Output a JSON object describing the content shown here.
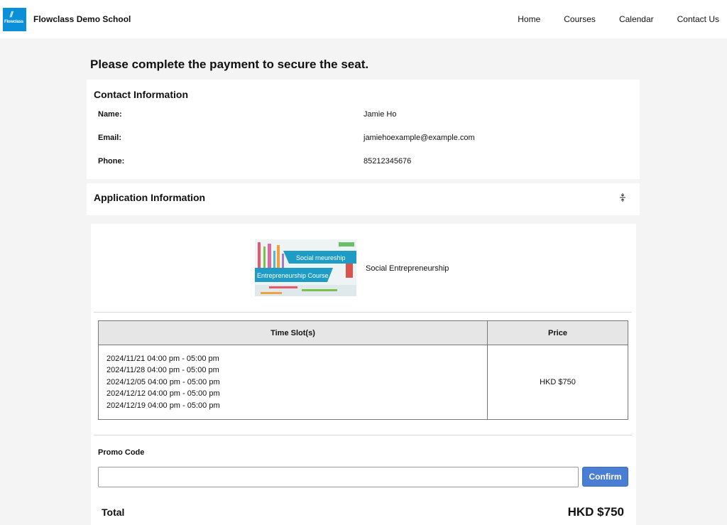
{
  "header": {
    "logo_text": "Flowclass",
    "school_name": "Flowclass Demo School",
    "nav": [
      "Home",
      "Courses",
      "Calendar",
      "Contact Us"
    ]
  },
  "page_heading": "Please complete the payment to secure the seat.",
  "contact": {
    "title": "Contact Information",
    "fields": [
      {
        "label": "Name:",
        "value": "Jamie Ho"
      },
      {
        "label": "Email:",
        "value": "jamiehoexample@example.com"
      },
      {
        "label": "Phone:",
        "value": "85212345676"
      }
    ]
  },
  "application": {
    "title": "Application Information",
    "toggle_icon": "expand-collapse-icon"
  },
  "order": {
    "course_name": "Social Entrepreneurship",
    "thumbnail_text": {
      "line1": "Social rneureship",
      "line2": "Entrepreneurship Course"
    },
    "table": {
      "headers": [
        "Time Slot(s)",
        "Price"
      ],
      "slots": [
        "2024/11/21 04:00 pm - 05:00 pm",
        "2024/11/28 04:00 pm - 05:00 pm",
        "2024/12/05 04:00 pm - 05:00 pm",
        "2024/12/12 04:00 pm - 05:00 pm",
        "2024/12/19 04:00 pm - 05:00 pm"
      ],
      "price": "HKD $750"
    },
    "promo_label": "Promo Code",
    "promo_value": "",
    "confirm_label": "Confirm",
    "total_label": "Total",
    "total_value": "HKD $750"
  },
  "colors": {
    "brand": "#0a8fd8",
    "button": "#4a7dd4",
    "page_bg": "#f4f4f4",
    "table_header_bg": "#e6e6e6"
  }
}
